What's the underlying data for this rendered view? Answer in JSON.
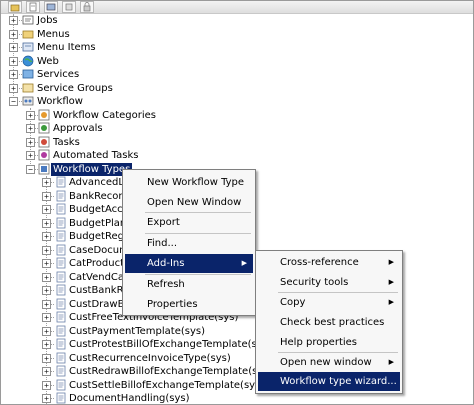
{
  "tree": {
    "top_items": [
      {
        "label": "Jobs",
        "icon": "jobs-icon"
      },
      {
        "label": "Menus",
        "icon": "menu-folder-icon"
      },
      {
        "label": "Menu Items",
        "icon": "menu-items-icon"
      },
      {
        "label": "Web",
        "icon": "web-globe-icon"
      },
      {
        "label": "Services",
        "icon": "services-icon"
      },
      {
        "label": "Service Groups",
        "icon": "service-groups-icon"
      },
      {
        "label": "Workflow",
        "icon": "workflow-icon"
      }
    ],
    "workflow_children": [
      {
        "label": "Workflow Categories",
        "icon": "workflow-categories-icon"
      },
      {
        "label": "Approvals",
        "icon": "approvals-icon"
      },
      {
        "label": "Tasks",
        "icon": "tasks-icon"
      },
      {
        "label": "Automated Tasks",
        "icon": "automated-tasks-icon"
      },
      {
        "label": "Workflow Types",
        "icon": "workflow-types-icon"
      }
    ],
    "type_items": [
      "AdvancedLed",
      "BankReconcili",
      "BudgetAccour",
      "BudgetPlanRe",
      "BudgetRegistr",
      "CaseDocumen",
      "CatProductAp",
      "CatVendCatal",
      "CustBankRem",
      "CustDrawBillof",
      "CustFreeTextInvoiceTemplate(sys)",
      "CustPaymentTemplate(sys)",
      "CustProtestBillOfExchangeTemplate(sys)",
      "CustRecurrenceInvoiceType(sys)",
      "CustRedrawBillofExchangeTemplate(sys)",
      "CustSettleBillofExchangeTemplate(sys)",
      "DocumentHandling(sys)"
    ]
  },
  "context_menu": {
    "items": [
      {
        "label": "New Workflow Type"
      },
      {
        "label": "Open New Window"
      },
      {
        "label": "Export"
      },
      {
        "label": "Find..."
      },
      {
        "label": "Add-Ins"
      },
      {
        "label": "Refresh"
      },
      {
        "label": "Properties"
      }
    ]
  },
  "submenu": {
    "items": [
      {
        "label": "Cross-reference"
      },
      {
        "label": "Security tools"
      },
      {
        "label": "Copy"
      },
      {
        "label": "Check best practices"
      },
      {
        "label": "Help properties"
      },
      {
        "label": "Open new window"
      },
      {
        "label": "Workflow type wizard..."
      }
    ]
  },
  "colors": {
    "selection": "#0a246a",
    "menu_bg": "#f7f7f7"
  }
}
